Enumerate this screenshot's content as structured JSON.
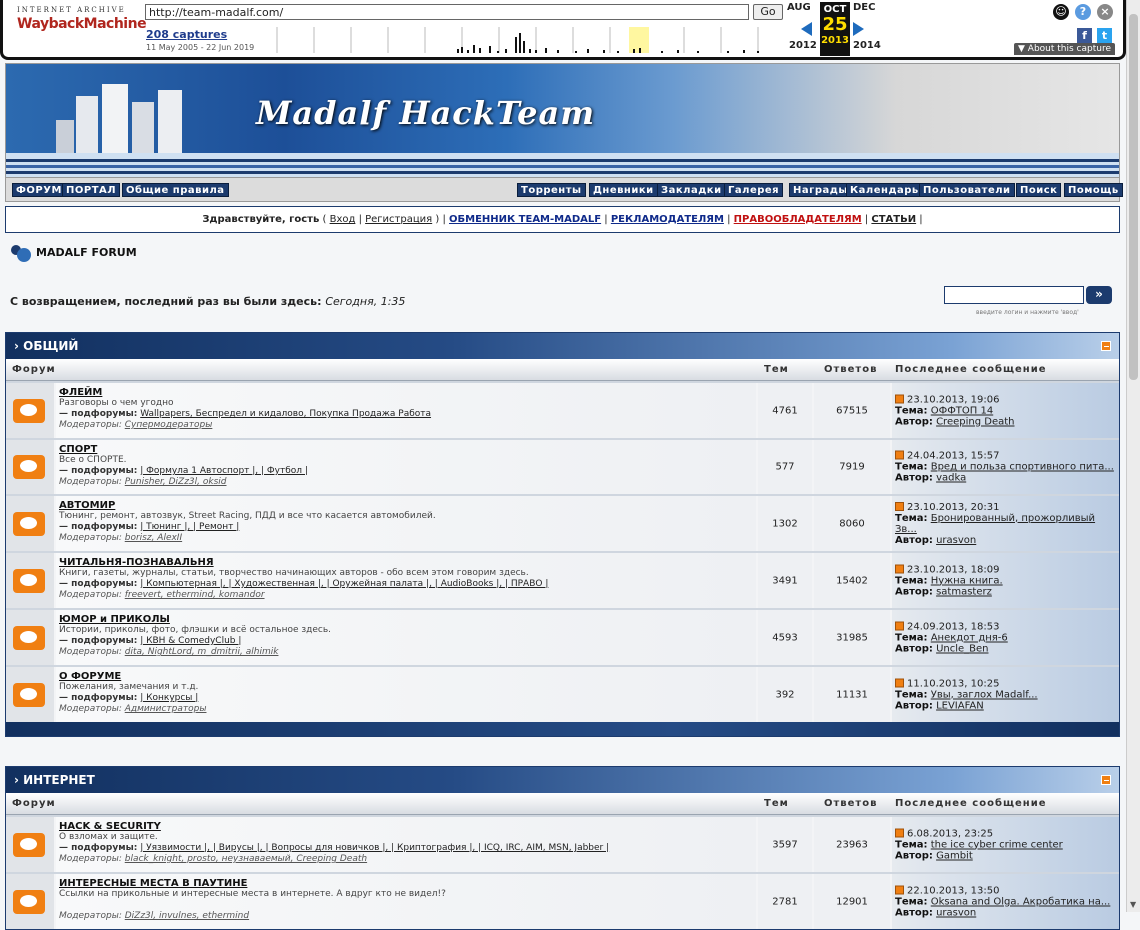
{
  "wayback": {
    "logo_top": "INTERNET ARCHIVE",
    "logo_main": "WaybackMachine",
    "url": "http://team-madalf.com/",
    "go": "Go",
    "captures": "208 captures",
    "range": "11 May 2005 - 22 Jun 2019",
    "prev_month": "AUG",
    "cur_month": "OCT",
    "next_month": "DEC",
    "day": "25",
    "prev_year": "2012",
    "cur_year": "2013",
    "next_year": "2014",
    "about": "▼ About this capture"
  },
  "banner": {
    "title": "Madalf HackTeam"
  },
  "nav_left": [
    "ФОРУМ",
    "ПОРТАЛ",
    "Общие правила"
  ],
  "nav_right": [
    "Торренты",
    "Дневники",
    "Закладки",
    "Галерея",
    "Награды",
    "Календарь",
    "Пользователи",
    "Поиск",
    "Помощь"
  ],
  "greeting": {
    "hello": "Здравствуйте, гость",
    "login": "Вход",
    "register": "Регистрация",
    "exchange": "ОБМЕННИК TEAM-MADALF",
    "ads": "РЕКЛАМОДАТЕЛЯМ",
    "rights": "ПРАВООБЛАДАТЕЛЯМ",
    "articles": "СТАТЬИ"
  },
  "forum_name": "MADALF FORUM",
  "welcome": {
    "text": "С возвращением, последний раз вы были здесь:",
    "when": "Сегодня, 1:35"
  },
  "login_box": {
    "go": "»",
    "hint": "введите логин и нажмите 'ввод'"
  },
  "columns": {
    "forum": "Форум",
    "topics": "Тем",
    "replies": "Ответов",
    "last": "Последнее сообщение"
  },
  "labels": {
    "sub": "— подфорумы:",
    "mods": "Модераторы:",
    "topic": "Тема:",
    "author": "Автор:"
  },
  "categories": [
    {
      "name": "ОБЩИЙ",
      "forums": [
        {
          "title": "ФЛЕЙМ",
          "desc": "Разговоры о чем угодно",
          "subs": "Wallpapers, Беспредел и кидалово, Покупка Продажа Работа",
          "mods": "Супермодераторы",
          "topics": "4761",
          "replies": "67515",
          "date": "23.10.2013, 19:06",
          "topic": "ОФФТОП 14",
          "author": "Creeping Death"
        },
        {
          "title": "СПОРТ",
          "desc": "Все о СПОРТЕ.",
          "subs": "| Формула 1 Автоспорт |, | Футбол |",
          "mods": "Punisher, DiZz3l, oksid",
          "topics": "577",
          "replies": "7919",
          "date": "24.04.2013, 15:57",
          "topic": "Вред и польза спортивного пита...",
          "author": "vadka"
        },
        {
          "title": "АВТОМИР",
          "desc": "Тюнинг, ремонт, автозвук, Street Racing, ПДД и все что касается автомобилей.",
          "subs": "| Тюнинг |, | Ремонт |",
          "mods": "borisz, AlexII",
          "topics": "1302",
          "replies": "8060",
          "date": "23.10.2013, 20:31",
          "topic": "Бронированный, прожорливый Зв...",
          "author": "urasvon"
        },
        {
          "title": "ЧИТАЛЬНЯ-ПОЗНАВАЛЬНЯ",
          "desc": "Книги, газеты, журналы, статьи, творчество начинающих авторов - обо всем этом говорим здесь.",
          "subs": "| Компьютерная |, | Художественная |, | Оружейная палата |, | AudioBooks |, | ПРАВО |",
          "mods": "freevert, ethermind, komandor",
          "topics": "3491",
          "replies": "15402",
          "date": "23.10.2013, 18:09",
          "topic": "Нужна книга.",
          "author": "satmasterz"
        },
        {
          "title": "ЮМОР и ПРИКОЛЫ",
          "desc": "Истории, приколы, фото, флэшки и всё остальное здесь.",
          "subs": "| КВН & ComedyClub |",
          "mods": "dita, NightLord, m_dmitrii, alhimik",
          "topics": "4593",
          "replies": "31985",
          "date": "24.09.2013, 18:53",
          "topic": "Анекдот дня-6",
          "author": "Uncle_Ben"
        },
        {
          "title": "О ФОРУМЕ",
          "desc": "Пожелания, замечания и т.д.",
          "subs": "| Конкурсы |",
          "mods": "Администраторы",
          "topics": "392",
          "replies": "11131",
          "date": "11.10.2013, 10:25",
          "topic": "Увы, заглох Madalf...",
          "author": "LEVIAFAN"
        }
      ]
    },
    {
      "name": "ИНТЕРНЕТ",
      "forums": [
        {
          "title": "HACK & SECURITY",
          "desc": "О взломах и защите.",
          "subs": "| Уязвимости |, | Вирусы |, | Вопросы для новичков |, | Криптография |, | ICQ, IRC, AIM, MSN, Jabber |",
          "mods": "black_knight, prosto, неузнаваемый, Creeping Death",
          "topics": "3597",
          "replies": "23963",
          "date": "6.08.2013, 23:25",
          "topic": "the ice cyber crime center",
          "author": "Gambit"
        },
        {
          "title": "ИНТЕРЕСНЫЕ МЕСТА В ПАУТИНЕ",
          "desc": "Ссылки на прикольные и интересные места в интернете. А вдруг кто не видел!?",
          "subs": "",
          "mods": "DiZz3l, invulnes, ethermind",
          "topics": "2781",
          "replies": "12901",
          "date": "22.10.2013, 13:50",
          "topic": "Oksana and Olga. Акробатика на...",
          "author": "urasvon"
        }
      ]
    }
  ]
}
